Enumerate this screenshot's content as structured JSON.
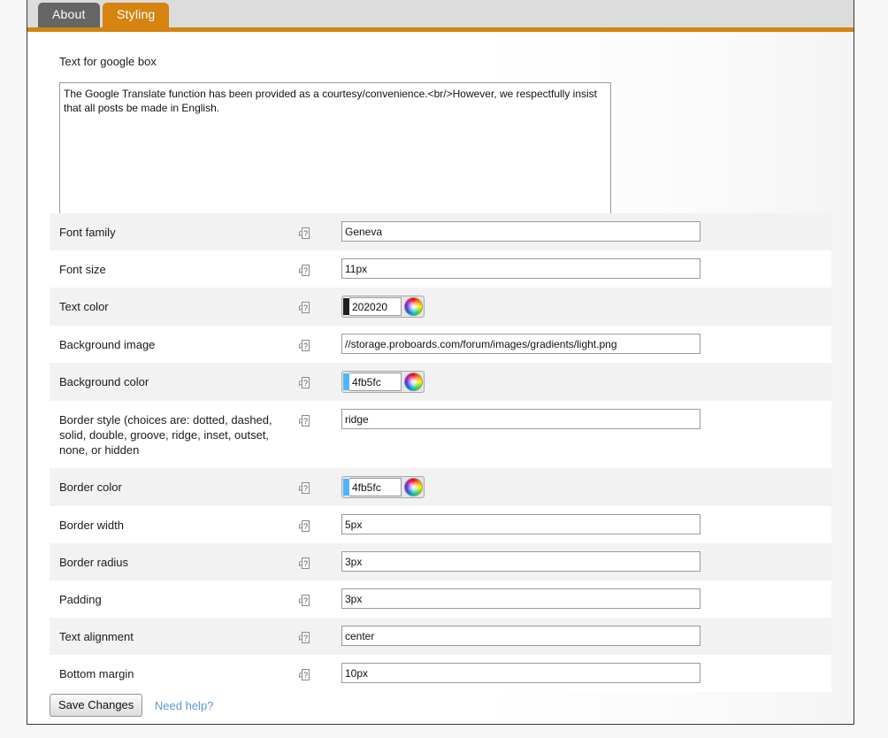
{
  "tabs": [
    {
      "label": "About",
      "active": false
    },
    {
      "label": "Styling",
      "active": true
    }
  ],
  "theme": {
    "accent": "#d4840f",
    "tab_inactive": "#656565",
    "tabstrip_bg": "#dcdcdc",
    "row_alt_bg": "#f2f2f2",
    "link_color": "#5b9bd5"
  },
  "help_icon_glyph": "?",
  "top_field": {
    "label": "Text for google box",
    "help_icon": "help-placeholder-icon",
    "value": "The Google Translate function has been provided as a courtesy/convenience.<br/>However, we respectfully insist that all posts be made in English.",
    "placeholder": ""
  },
  "settings": [
    {
      "label": "Font family",
      "type": "text",
      "value": "Geneva",
      "placeholder": ""
    },
    {
      "label": "Font size",
      "type": "text",
      "value": "11px",
      "placeholder": ""
    },
    {
      "label": "Text color",
      "type": "color",
      "value": "202020",
      "swatch": "#202020",
      "placeholder": ""
    },
    {
      "label": "Background image",
      "type": "text",
      "value": "//storage.proboards.com/forum/images/gradients/light.png",
      "placeholder": ""
    },
    {
      "label": "Background color",
      "type": "color",
      "value": "4fb5fc",
      "swatch": "#4fb5fc",
      "placeholder": ""
    },
    {
      "label": "Border style (choices are: dotted, dashed, solid, double, groove, ridge, inset, outset, none, or hidden",
      "type": "text",
      "value": "ridge",
      "placeholder": ""
    },
    {
      "label": "Border color",
      "type": "color",
      "value": "4fb5fc",
      "swatch": "#4fb5fc",
      "placeholder": ""
    },
    {
      "label": "Border width",
      "type": "text",
      "value": "5px",
      "placeholder": ""
    },
    {
      "label": "Border radius",
      "type": "text",
      "value": "3px",
      "placeholder": ""
    },
    {
      "label": "Padding",
      "type": "text",
      "value": "3px",
      "placeholder": ""
    },
    {
      "label": "Text alignment",
      "type": "text",
      "value": "center",
      "placeholder": ""
    },
    {
      "label": "Bottom margin",
      "type": "text",
      "value": "10px",
      "placeholder": ""
    }
  ],
  "footer": {
    "save_label": "Save Changes",
    "help_link": "Need help?"
  }
}
